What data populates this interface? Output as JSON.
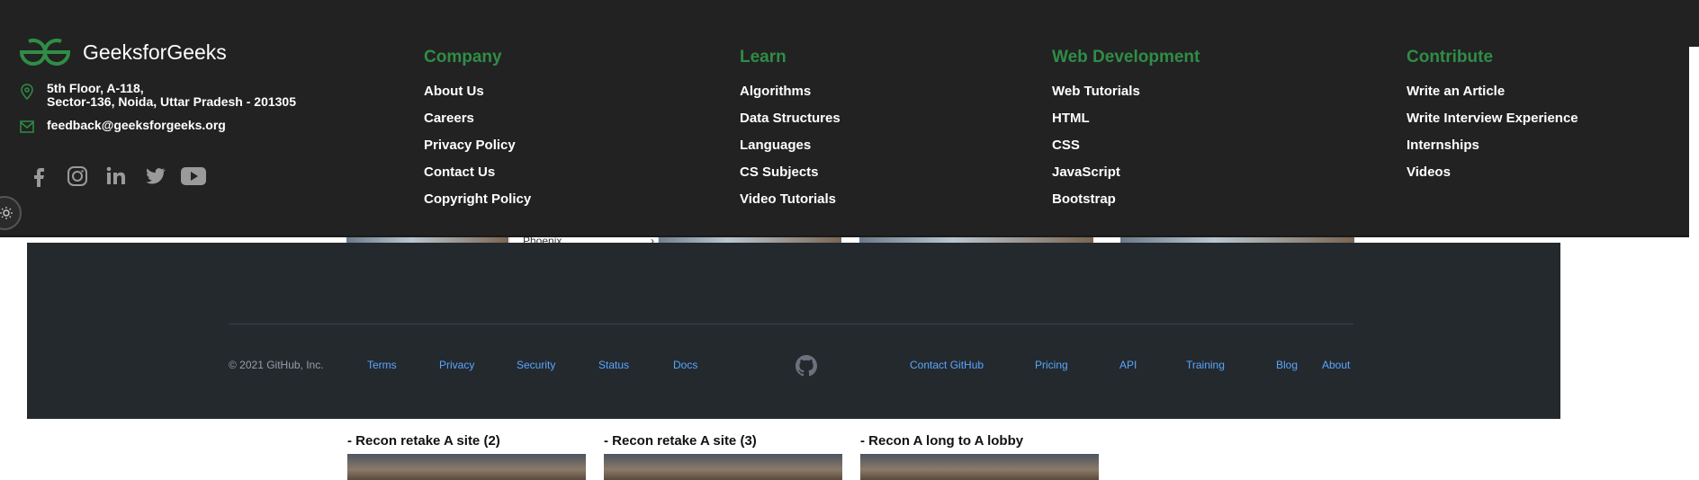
{
  "gfg_footer": {
    "brand": "GeeksforGeeks",
    "address_line1": "5th Floor, A-118,",
    "address_line2": "Sector-136, Noida, Uttar Pradesh - 201305",
    "email": "feedback@geeksforgeeks.org",
    "social_icons": [
      "facebook-icon",
      "instagram-icon",
      "linkedin-icon",
      "twitter-icon",
      "youtube-icon"
    ],
    "columns": [
      {
        "title": "Company",
        "links": [
          "About Us",
          "Careers",
          "Privacy Policy",
          "Contact Us",
          "Copyright Policy"
        ]
      },
      {
        "title": "Learn",
        "links": [
          "Algorithms",
          "Data Structures",
          "Languages",
          "CS Subjects",
          "Video Tutorials"
        ]
      },
      {
        "title": "Web Development",
        "links": [
          "Web Tutorials",
          "HTML",
          "CSS",
          "JavaScript",
          "Bootstrap"
        ]
      },
      {
        "title": "Contribute",
        "links": [
          "Write an Article",
          "Write Interview Experience",
          "Internships",
          "Videos"
        ]
      }
    ],
    "accent_color": "#2f8d46"
  },
  "github_footer": {
    "copyright": "© 2021 GitHub, Inc.",
    "left_links": [
      "Terms",
      "Privacy",
      "Security",
      "Status",
      "Docs"
    ],
    "right_links": [
      "Contact GitHub",
      "Pricing",
      "API",
      "Training",
      "Blog",
      "About"
    ],
    "link_color": "#58a6ff"
  },
  "underlying": {
    "dropdown_value": "Phoenix",
    "captions": [
      "- Recon retake A site (2)",
      "- Recon retake A site (3)",
      "- Recon A long to A lobby"
    ]
  }
}
